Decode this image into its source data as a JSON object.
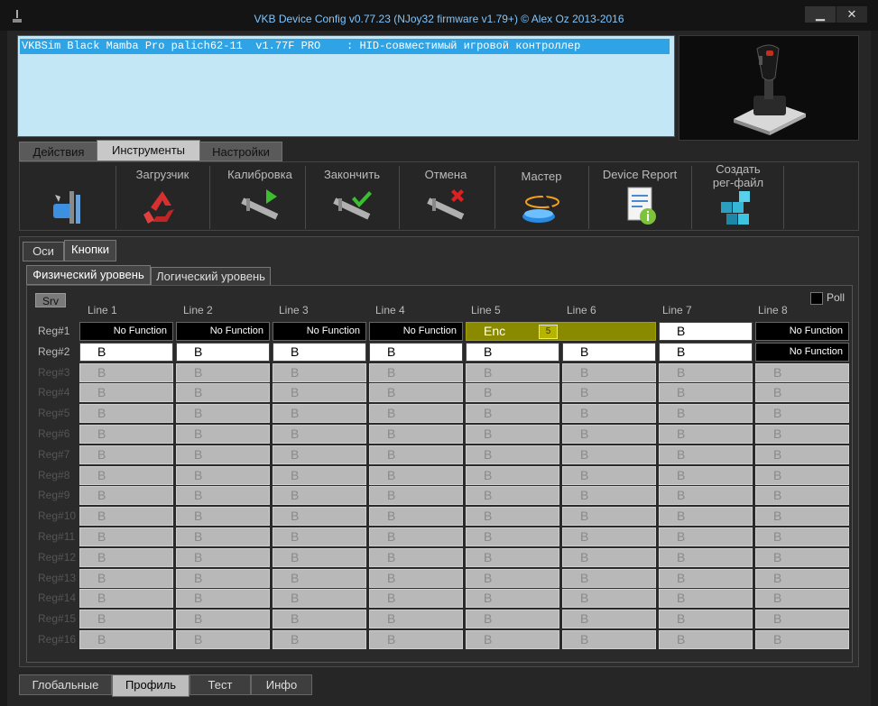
{
  "window": {
    "title": "VKB Device Config v0.77.23 (NJoy32 firmware v1.79+) © Alex Oz 2013-2016",
    "minimize": "▁",
    "close": "✕"
  },
  "device_list": {
    "selected_row": "VKBSim Black Mamba Pro palich62-11  v1.77F PRO    : HID-совместимый игровой контроллер"
  },
  "main_tabs": [
    "Действия",
    "Инструменты",
    "Настройки"
  ],
  "toolbar": {
    "loader": "Загрузчик",
    "calibration": "Калибровка",
    "finish": "Закончить",
    "cancel": "Отмена",
    "wizard": "Мастер",
    "device_report": "Device Report",
    "create_reg_1": "Создать",
    "create_reg_2": "рег-файл"
  },
  "sub_tabs": [
    "Оси",
    "Кнопки"
  ],
  "level_tabs": [
    "Физический уровень",
    "Логический уровень"
  ],
  "srv_button": "Srv",
  "poll_label": "Poll",
  "lines": [
    "Line 1",
    "Line 2",
    "Line 3",
    "Line 4",
    "Line 5",
    "Line 6",
    "Line 7",
    "Line 8"
  ],
  "regs": [
    "Reg#1",
    "Reg#2",
    "Reg#3",
    "Reg#4",
    "Reg#5",
    "Reg#6",
    "Reg#7",
    "Reg#8",
    "Reg#9",
    "Reg#10",
    "Reg#11",
    "Reg#12",
    "Reg#13",
    "Reg#14",
    "Reg#15",
    "Reg#16"
  ],
  "grid": {
    "row1": [
      "No Function",
      "No Function",
      "No Function",
      "No Function",
      "Enc",
      "",
      "B",
      "No Function"
    ],
    "enc_count": "5",
    "row2": [
      "B",
      "B",
      "B",
      "B",
      "B",
      "B",
      "B",
      "No Function"
    ],
    "disabled_value": "B"
  },
  "bottom_tabs": [
    "Глобальные",
    "Профиль",
    "Тест",
    "Инфо"
  ],
  "colors": {
    "title": "#7ec6ff",
    "selection": "#2ea3e5",
    "encoder": "#8a8a00"
  }
}
